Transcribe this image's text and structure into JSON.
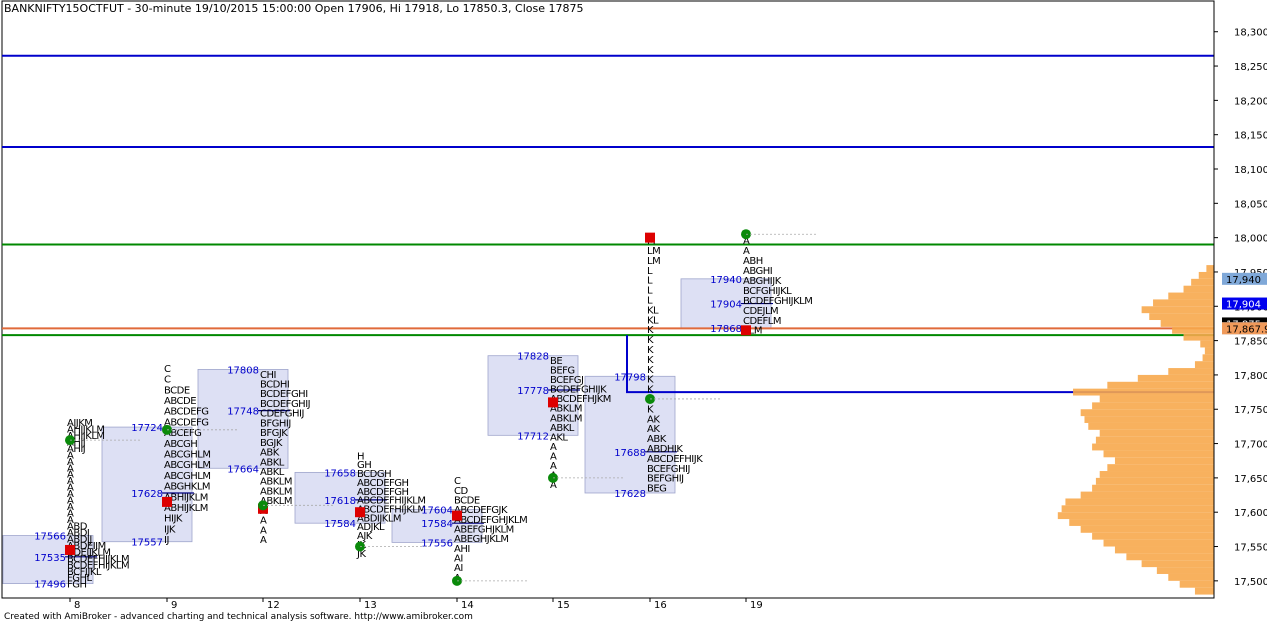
{
  "title": "BANKNIFTY15OCTFUT - 30-minute 19/10/2015 15:00:00 Open 17906, Hi 17918, Lo 17850.3, Close 17875",
  "footer": "Created with AmiBroker - advanced charting and technical analysis software. http://www.amibroker.com",
  "chart_data": {
    "type": "market-profile",
    "y_axis": {
      "range": [
        17475,
        18320
      ],
      "ticks": [
        17500,
        17550,
        17600,
        17650,
        17700,
        17750,
        17800,
        17850,
        17900,
        17950,
        18000,
        18050,
        18100,
        18150,
        18200,
        18250,
        18300
      ],
      "tick_labels": [
        "17,500",
        "17,550",
        "17,600",
        "17,650",
        "17,700",
        "17,750",
        "17,800",
        "17,850",
        "17,900",
        "17,950",
        "18,000",
        "18,050",
        "18,100",
        "18,150",
        "18,200",
        "18,250",
        "18,300"
      ]
    },
    "x_axis": {
      "labels": [
        "8",
        "9",
        "12",
        "13",
        "14",
        "15",
        "16",
        "19"
      ]
    },
    "price_badges": [
      {
        "label": "17,940",
        "value": 17940,
        "color": "#7fa8d8",
        "text_color": "#000000"
      },
      {
        "label": "17,904",
        "value": 17904,
        "color": "#0000ee",
        "text_color": "#ffffff"
      },
      {
        "label": "17,875",
        "value": 17875,
        "color": "#000000",
        "text_color": "#ffffff"
      },
      {
        "label": "17,868",
        "value": 17868,
        "color": "#8fb0d8",
        "text_color": "#000000"
      },
      {
        "label": "17,867.9",
        "value": 17867.9,
        "color": "#f09a5a",
        "text_color": "#000000"
      }
    ],
    "horizontal_lines": [
      {
        "value": 18265,
        "color": "#0000cc"
      },
      {
        "value": 18132,
        "color": "#0000cc"
      },
      {
        "value": 17990,
        "color": "#008800"
      },
      {
        "value": 17867.9,
        "color": "#e06a3a"
      },
      {
        "value": 17858,
        "color": "#008800"
      }
    ],
    "sessions": [
      {
        "date": "8",
        "val": 17496,
        "poc": 17535,
        "vah": 17566,
        "open": 17545,
        "close": 17705,
        "high": 17735,
        "low": 17490,
        "letters": [
          "FGH",
          "FGHL",
          "BCFIJKL",
          "BCDEFHIJKLM",
          "BCDEFHIJKLM",
          "BDEIJKLM",
          "ABDEIJM",
          "ABDIJ",
          "ABDI",
          "ABD",
          "A",
          "A",
          "A",
          "A",
          "A",
          "A",
          "A",
          "A",
          "A",
          "A",
          "A",
          "AHIJ",
          "AHIJ",
          "AHIJKLM",
          "AHIJKLM",
          "AIJKM"
        ],
        "label_vah": "17566",
        "label_poc": "17535",
        "label_val": "17496"
      },
      {
        "date": "9",
        "val": 17557,
        "poc": 17628,
        "vah": 17724,
        "open": 17615,
        "close": 17720,
        "high": 17820,
        "low": 17555,
        "letters": [
          "IJ",
          "IJK",
          "HIJK",
          "ABHIJKLM",
          "ABHIJKLM",
          "ABGHKLM",
          "ABCGHLM",
          "ABCGHLM",
          "ABCGHLM",
          "ABCGH",
          "ABCEFG",
          "ABCDEFG",
          "ABCDEFG",
          "ABCDE",
          "BCDE",
          "C",
          "C"
        ],
        "label_vah": "17724",
        "label_poc": "17628",
        "label_val": "17557"
      },
      {
        "date": "12",
        "val": 17664,
        "poc": 17748,
        "vah": 17808,
        "open": 17605,
        "close": 17610,
        "high": 17810,
        "low": 17555,
        "letters": [
          "A",
          "A",
          "A",
          "A",
          "ABKLM",
          "ABKLM",
          "ABKLM",
          "ABKL",
          "ABKL",
          "ABK",
          "BGJK",
          "BFGJK",
          "BFGHIJ",
          "CDEFGHIJ",
          "BCDEFGHIJ",
          "BCDEFGHI",
          "BCDHI",
          "CHI"
        ],
        "label_vah": "17808",
        "label_poc": "17748",
        "label_val": "17664"
      },
      {
        "date": "13",
        "val": 17584,
        "poc": 17618,
        "vah": 17658,
        "open": 17600,
        "close": 17550,
        "high": 17690,
        "low": 17535,
        "letters": [
          "JK",
          "JK",
          "AJK",
          "ADJKL",
          "ABDIJKLM",
          "ABCDEFHIJKLM",
          "ABCDEFHIJKLM",
          "ABCDEFGH",
          "ABCDEFGH",
          "BCDGH",
          "GH",
          "H"
        ],
        "label_vah": "17658",
        "label_poc": "17618",
        "label_val": "17584"
      },
      {
        "date": "14",
        "val": 17556,
        "poc": 17584,
        "vah": 17604,
        "open": 17595,
        "close": 17500,
        "high": 17655,
        "low": 17500,
        "letters": [
          "A",
          "AI",
          "AI",
          "AHI",
          "ABEGHJKLM",
          "ABEFGHJKLM",
          "ABCDEFGHJKLM",
          "ABCDEFGJK",
          "BCDE",
          "CD",
          "C"
        ],
        "label_vah": "17604",
        "label_poc": "17584",
        "label_val": "17556"
      },
      {
        "date": "15",
        "val": 17712,
        "poc": 17778,
        "vah": 17828,
        "open": 17760,
        "close": 17650,
        "high": 17830,
        "low": 17635,
        "letters": [
          "A",
          "A",
          "A",
          "A",
          "A",
          "AKL",
          "ABKL",
          "ABKLM",
          "ABKLM",
          "ABCDEFHJKM",
          "BCDEFGHIJK",
          "BCEFGJ",
          "BEFG",
          "BE"
        ],
        "label_vah": "17828",
        "label_poc": "17778",
        "label_val": "17712"
      },
      {
        "date": "16",
        "val": 17628,
        "poc": 17688,
        "vah": 17798,
        "open": 18000,
        "close": 17765,
        "high": 18005,
        "low": 17630,
        "letters": [
          "BEG",
          "BEFGHIJ",
          "BCEFGHIJ",
          "ABCDEFHIJK",
          "ABDHIK",
          "ABK",
          "AK",
          "AK",
          "K",
          "K",
          "K",
          "K",
          "K",
          "K",
          "K",
          "K",
          "K",
          "KL",
          "KL",
          "L",
          "L",
          "L",
          "L",
          "LM",
          "LM",
          "M"
        ],
        "label_vah": "17798",
        "label_poc": "17688",
        "label_val": "17628"
      },
      {
        "date": "19",
        "val": 17868,
        "poc": 17904,
        "vah": 17940,
        "open": 17865,
        "close": 18005,
        "high": 18005,
        "low": 17860,
        "letters": [
          "ELM",
          "CDEFLM",
          "CDEJLM",
          "BCDEFGHIJKLM",
          "BCFGHIJKL",
          "ABGHIJK",
          "ABGHI",
          "ABH",
          "A",
          "A"
        ],
        "label_vah": "17940",
        "label_poc": "17904",
        "label_val": "17868"
      }
    ],
    "volume_profile": [
      [
        17485,
        25
      ],
      [
        17495,
        45
      ],
      [
        17505,
        60
      ],
      [
        17515,
        75
      ],
      [
        17525,
        95
      ],
      [
        17535,
        115
      ],
      [
        17545,
        130
      ],
      [
        17555,
        145
      ],
      [
        17565,
        160
      ],
      [
        17575,
        175
      ],
      [
        17585,
        190
      ],
      [
        17595,
        205
      ],
      [
        17605,
        200
      ],
      [
        17615,
        195
      ],
      [
        17625,
        175
      ],
      [
        17635,
        160
      ],
      [
        17645,
        155
      ],
      [
        17655,
        150
      ],
      [
        17665,
        140
      ],
      [
        17675,
        130
      ],
      [
        17685,
        145
      ],
      [
        17695,
        160
      ],
      [
        17705,
        155
      ],
      [
        17715,
        150
      ],
      [
        17725,
        165
      ],
      [
        17735,
        170
      ],
      [
        17745,
        175
      ],
      [
        17755,
        160
      ],
      [
        17765,
        150
      ],
      [
        17775,
        185
      ],
      [
        17785,
        140
      ],
      [
        17795,
        100
      ],
      [
        17805,
        60
      ],
      [
        17815,
        25
      ],
      [
        17825,
        15
      ],
      [
        17835,
        12
      ],
      [
        17845,
        18
      ],
      [
        17855,
        40
      ],
      [
        17865,
        55
      ],
      [
        17875,
        70
      ],
      [
        17885,
        85
      ],
      [
        17895,
        95
      ],
      [
        17905,
        80
      ],
      [
        17915,
        60
      ],
      [
        17925,
        40
      ],
      [
        17935,
        30
      ],
      [
        17945,
        20
      ],
      [
        17955,
        10
      ]
    ]
  }
}
